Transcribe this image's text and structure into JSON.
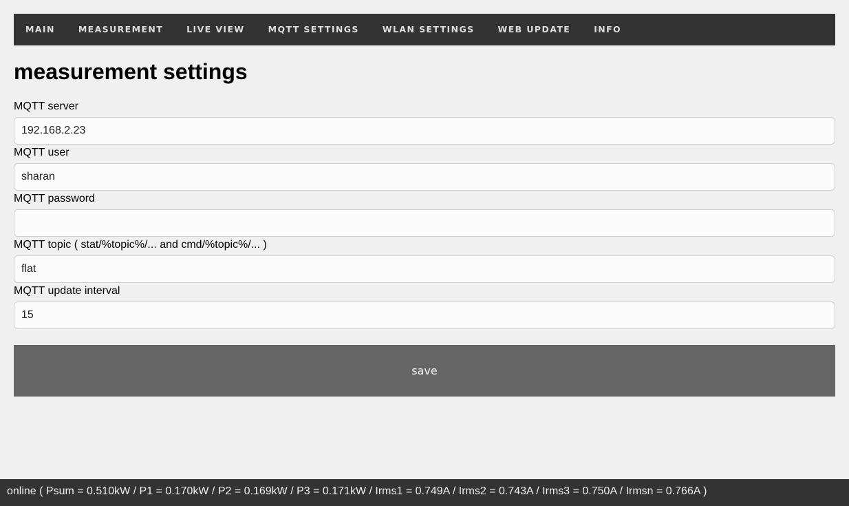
{
  "nav": {
    "items": [
      {
        "label": "MAIN"
      },
      {
        "label": "MEASUREMENT"
      },
      {
        "label": "LIVE VIEW"
      },
      {
        "label": "MQTT SETTINGS"
      },
      {
        "label": "WLAN SETTINGS"
      },
      {
        "label": "WEB UPDATE"
      },
      {
        "label": "INFO"
      }
    ]
  },
  "page": {
    "title": "measurement settings"
  },
  "form": {
    "fields": [
      {
        "label": "MQTT server",
        "value": "192.168.2.23"
      },
      {
        "label": "MQTT user",
        "value": "sharan"
      },
      {
        "label": "MQTT password",
        "value": ""
      },
      {
        "label": "MQTT topic ( stat/%topic%/... and cmd/%topic%/... )",
        "value": "flat"
      },
      {
        "label": "MQTT update interval",
        "value": "15"
      }
    ],
    "save_label": "save"
  },
  "status": {
    "text": "online ( Psum = 0.510kW / P1 = 0.170kW / P2 = 0.169kW / P3 = 0.171kW / Irms1 = 0.749A / Irms2 = 0.743A / Irms3 = 0.750A / Irmsn = 0.766A )"
  },
  "colors": {
    "navbar_bg": "#333333",
    "page_bg": "#f0f0f0",
    "button_bg": "#666666",
    "statusbar_bg": "#333333"
  }
}
